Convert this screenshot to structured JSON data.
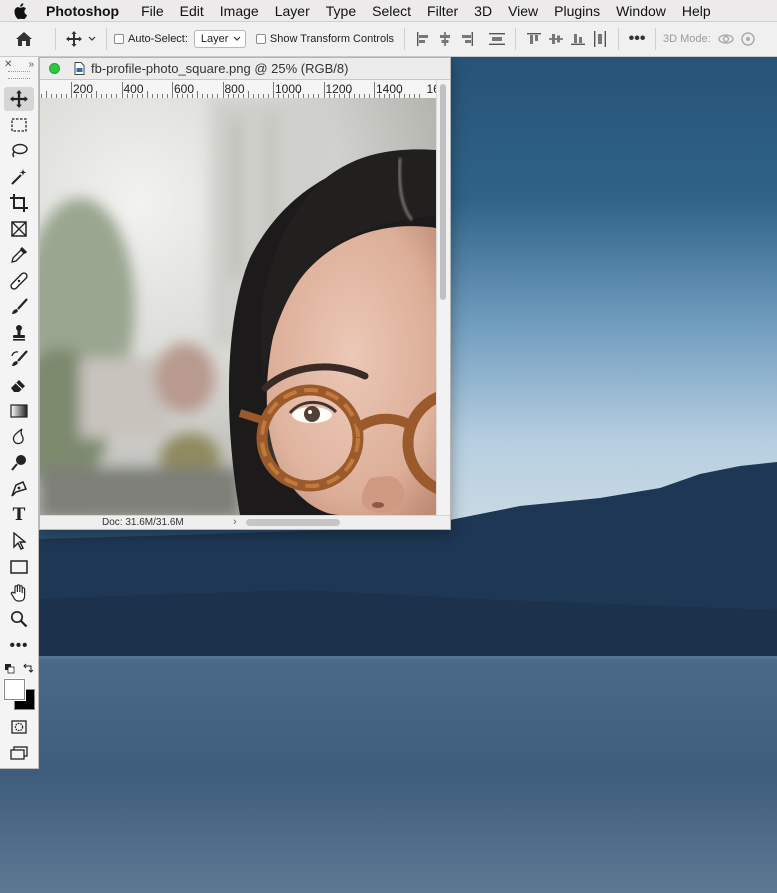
{
  "menubar": {
    "app_name": "Photoshop",
    "items": [
      "File",
      "Edit",
      "Image",
      "Layer",
      "Type",
      "Select",
      "Filter",
      "3D",
      "View",
      "Plugins",
      "Window",
      "Help"
    ]
  },
  "options_bar": {
    "auto_select_label": "Auto-Select:",
    "auto_select_checked": false,
    "layer_select_value": "Layer",
    "show_transform_label": "Show Transform Controls",
    "show_transform_checked": false,
    "mode_3d_label": "3D Mode:"
  },
  "document": {
    "title": "fb-profile-photo_square.png @ 25% (RGB/8)",
    "zoom_percent": 25,
    "ruler_labels": [
      "200",
      "400",
      "600",
      "800",
      "1000",
      "1200",
      "1400",
      "16"
    ],
    "status_text": "Doc: 31.6M/31.6M"
  },
  "tools": [
    {
      "name": "move-tool-icon",
      "active": true
    },
    {
      "name": "marquee-tool-icon"
    },
    {
      "name": "lasso-tool-icon"
    },
    {
      "name": "magic-wand-icon"
    },
    {
      "name": "crop-tool-icon"
    },
    {
      "name": "frame-tool-icon"
    },
    {
      "name": "eyedropper-icon"
    },
    {
      "name": "healing-brush-icon"
    },
    {
      "name": "brush-tool-icon"
    },
    {
      "name": "clone-stamp-icon"
    },
    {
      "name": "history-brush-icon"
    },
    {
      "name": "eraser-icon"
    },
    {
      "name": "gradient-tool-icon"
    },
    {
      "name": "blur-tool-icon"
    },
    {
      "name": "dodge-tool-icon"
    },
    {
      "name": "pen-tool-icon"
    },
    {
      "name": "type-tool-icon"
    },
    {
      "name": "path-selection-icon"
    },
    {
      "name": "rectangle-tool-icon"
    },
    {
      "name": "hand-tool-icon"
    },
    {
      "name": "zoom-tool-icon"
    },
    {
      "name": "more-tools-icon"
    }
  ],
  "type_tool_glyph": "T",
  "colors": {
    "foreground": "#ffffff",
    "background": "#000000",
    "sky_top": "#1f4a6c",
    "sky_horizon": "#b9cfdf",
    "water": "#3d5a78"
  }
}
